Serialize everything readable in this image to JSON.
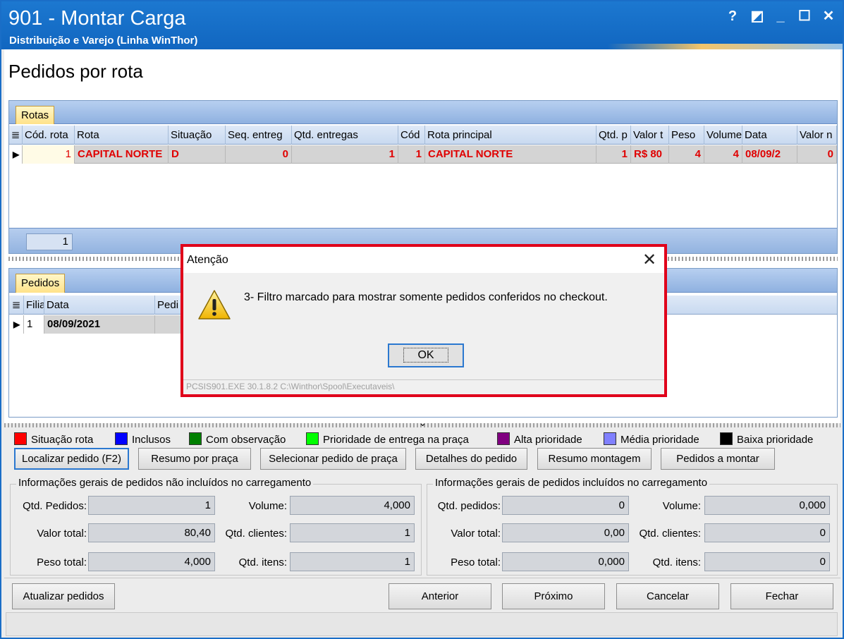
{
  "window": {
    "title": "901 - Montar Carga",
    "subtitle": "Distribuição e Varejo (Linha WinThor)",
    "controls": [
      "?",
      "◩",
      "_",
      "☐",
      "✕"
    ]
  },
  "page": {
    "title": "Pedidos por rota"
  },
  "rotas": {
    "tab_label": "Rotas",
    "columns": [
      "Cód. rota",
      "Rota",
      "Situação",
      "Seq. entreg",
      "Qtd. entregas",
      "Cód",
      "Rota principal",
      "Qtd. p",
      "Valor t",
      "Peso",
      "Volume",
      "Data",
      "Valor n"
    ],
    "rows": [
      {
        "cod_rota": "1",
        "rota": "CAPITAL NORTE",
        "situacao": "D",
        "seq_entrega": "0",
        "qtd_entregas": "1",
        "cod": "1",
        "rota_principal": "CAPITAL NORTE",
        "qtd_p": "1",
        "valor_t": "R$ 80",
        "peso": "4",
        "volume": "4",
        "data": "08/09/2",
        "valor_n": "0"
      }
    ],
    "footer_count": "1"
  },
  "pedidos": {
    "tab_label": "Pedidos",
    "columns": [
      "Filia",
      "Data",
      "Pedi"
    ],
    "rows": [
      {
        "filial": "1",
        "data": "08/09/2021"
      }
    ]
  },
  "legend": [
    {
      "label": "Situação rota",
      "color": "#ff0000"
    },
    {
      "label": "Inclusos",
      "color": "#0000ff"
    },
    {
      "label": "Com observação",
      "color": "#008000"
    },
    {
      "label": "Prioridade de entrega na praça",
      "color": "#00ff00"
    },
    {
      "label": "Alta prioridade",
      "color": "#800080"
    },
    {
      "label": "Média prioridade",
      "color": "#8080ff"
    },
    {
      "label": "Baixa prioridade",
      "color": "#000000"
    }
  ],
  "actions": {
    "localizar": "Localizar pedido (F2)",
    "resumo_praca": "Resumo por praça",
    "selecionar_praca": "Selecionar pedido de praça",
    "detalhes": "Detalhes do pedido",
    "resumo_montagem": "Resumo montagem",
    "pedidos_montar": "Pedidos a montar"
  },
  "nao_incluidos": {
    "title": "Informações gerais de pedidos não incluídos no carregamento",
    "qtd_pedidos_label": "Qtd. Pedidos:",
    "qtd_pedidos": "1",
    "volume_label": "Volume:",
    "volume": "4,000",
    "valor_total_label": "Valor total:",
    "valor_total": "80,40",
    "qtd_clientes_label": "Qtd. clientes:",
    "qtd_clientes": "1",
    "peso_total_label": "Peso total:",
    "peso_total": "4,000",
    "qtd_itens_label": "Qtd. itens:",
    "qtd_itens": "1"
  },
  "incluidos": {
    "title": "Informações gerais de pedidos incluídos no carregamento",
    "qtd_pedidos_label": "Qtd. pedidos:",
    "qtd_pedidos": "0",
    "volume_label": "Volume:",
    "volume": "0,000",
    "valor_total_label": "Valor total:",
    "valor_total": "0,00",
    "qtd_clientes_label": "Qtd. clientes:",
    "qtd_clientes": "0",
    "peso_total_label": "Peso total:",
    "peso_total": "0,000",
    "qtd_itens_label": "Qtd. itens:",
    "qtd_itens": "0"
  },
  "bottom": {
    "atualizar": "Atualizar pedidos",
    "anterior": "Anterior",
    "proximo": "Próximo",
    "cancelar": "Cancelar",
    "fechar": "Fechar"
  },
  "dialog": {
    "title": "Atenção",
    "message": "3- Filtro marcado para mostrar somente pedidos conferidos no checkout.",
    "ok_label": "OK",
    "footer": "PCSIS901.EXE 30.1.8.2 C:\\Winthor\\Spool\\Executaveis\\"
  }
}
